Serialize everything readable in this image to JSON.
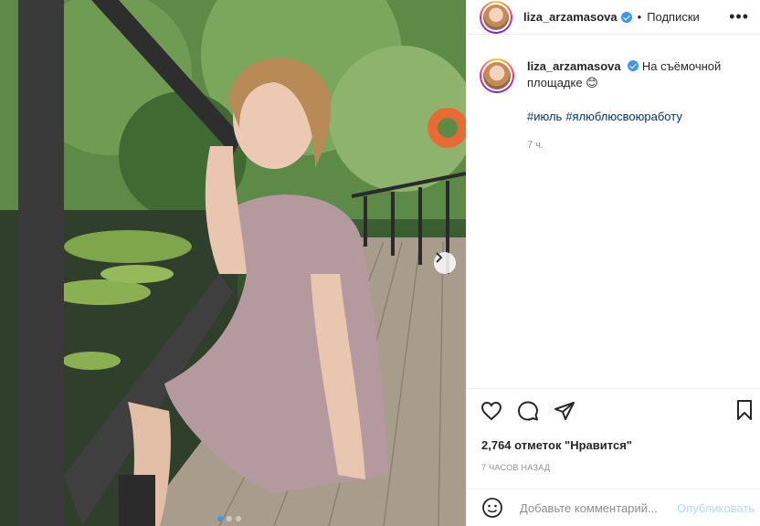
{
  "post": {
    "username": "liza_arzamasova",
    "follow_label": "Подписки",
    "separator": "•",
    "more_label": "•••",
    "caption_text": "На съёмочной площадке",
    "caption_emoji": "😊",
    "hashtags": [
      "#июль",
      "#ялюблюсвоюработу"
    ],
    "caption_time": "7 ч.",
    "likes_text": "2,764 отметок \"Нравится\"",
    "posted_time": "7 ЧАСОВ НАЗАД",
    "comment_placeholder": "Добавьте комментарий...",
    "publish_label": "Опубликовать",
    "carousel": {
      "total": 3,
      "active": 1
    }
  },
  "colors": {
    "link": "#00376b",
    "verified": "#3897f0",
    "muted": "#8e8e8e",
    "publish_disabled": "#b3dbff",
    "text": "#262626"
  },
  "icons": [
    "more-icon",
    "verified-icon",
    "heart-icon",
    "comment-icon",
    "share-icon",
    "bookmark-icon",
    "emoji-icon",
    "chevron-right-icon"
  ]
}
